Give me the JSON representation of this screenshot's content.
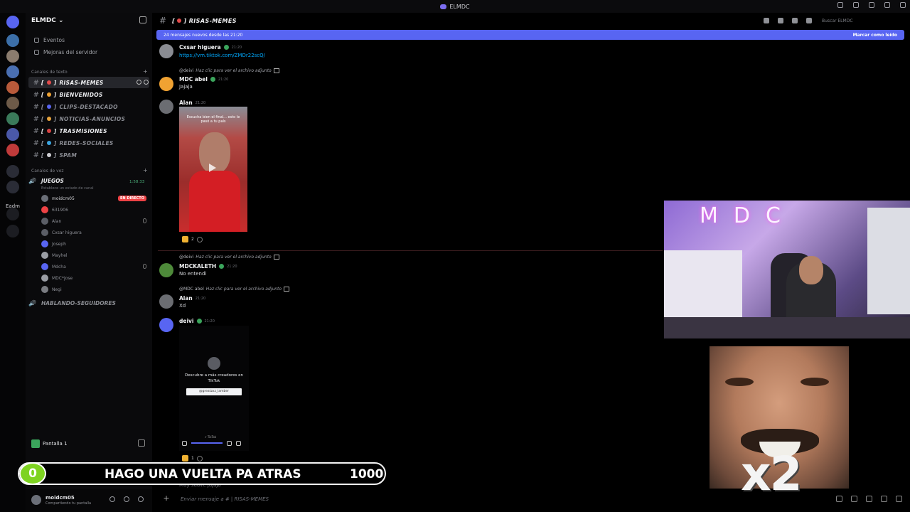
{
  "window": {
    "title": "ELMDC"
  },
  "server": {
    "name": "ELMDC",
    "links": [
      "Eventos",
      "Mejoras del servidor"
    ],
    "rail_label": "Eadm"
  },
  "text_category": "Canales de texto",
  "text_channels": [
    {
      "name": "RISAS-MEMES",
      "active": true
    },
    {
      "name": "BIENVENIDOS",
      "bright": true
    },
    {
      "name": "CLIPS-DESTACADO"
    },
    {
      "name": "NOTICIAS-ANUNCIOS"
    },
    {
      "name": "TRASMISIONES",
      "bright": true
    },
    {
      "name": "REDES-SOCIALES"
    },
    {
      "name": "SPAM"
    }
  ],
  "voice_category": "Canales de voz",
  "voice_channel": {
    "name": "JUEGOS",
    "time": "1:58:33",
    "status": "Establece un estado de canal",
    "users": [
      {
        "name": "moidcm05",
        "live": "EN DIRECTO",
        "color": "#6b6f78"
      },
      {
        "name": "631906",
        "color": "#ed4245"
      },
      {
        "name": "Alan",
        "color": "#5b5e66"
      },
      {
        "name": "Cxsar higuera",
        "color": "#5b5e66"
      },
      {
        "name": "Joseph",
        "color": "#5865f2"
      },
      {
        "name": "Mayhel",
        "color": "#9a9da4"
      },
      {
        "name": "Mdcha",
        "color": "#5865f2"
      },
      {
        "name": "MDC*jose",
        "color": "#9a9da4"
      },
      {
        "name": "Negi",
        "color": "#7a7c82"
      }
    ]
  },
  "voice_channel_2": {
    "name": "HABLANDO-SEGUIDORES"
  },
  "screen_share": {
    "label": "Pantalla 1"
  },
  "user_panel": {
    "name": "moidcm05",
    "status": "Compartiendo tu pantalla"
  },
  "channel_header": {
    "title": "RISAS-MEMES",
    "search_placeholder": "Buscar ELMDC"
  },
  "new_messages_bar": {
    "text": "24 mensajes nuevos desde las 21:20",
    "action": "Marcar como leído"
  },
  "messages": [
    {
      "author": "Cxsar higuera",
      "time": "21:20",
      "link": "https://vm.tiktok.com/ZMDr22scQ/"
    },
    {
      "reply_to": "@deivi",
      "reply_text": "Haz clic para ver el archivo adjunto",
      "author": "MDC abel",
      "time": "21:20",
      "text": "Jajaja"
    },
    {
      "author": "Alan",
      "time": "21:20",
      "video_caption": "Escucha bien el final... esto le pasó a tu país",
      "reaction_count": "2"
    },
    {
      "reply_to": "@deivi",
      "reply_text": "Haz clic para ver el archivo adjunto",
      "author": "MDCKALETH",
      "time": "21:20",
      "text": "No entendi"
    },
    {
      "reply_to": "@MDC abel",
      "reply_text": "Haz clic para ver el archivo adjunto",
      "author": "Alan",
      "time": "21:20",
      "text": "Xd"
    },
    {
      "author": "deivi",
      "time": "21:20",
      "video_text": "Descubre a más creadores en TikTok",
      "video_button": "@greatzxz_lamber",
      "video_credit": "♪ TikTok",
      "reaction_count": "1"
    }
  ],
  "hidden_message": {
    "text": "Muy suave jajaja"
  },
  "composer": {
    "placeholder": "Enviar mensaje a # | RISAS-MEMES"
  },
  "overlay": {
    "goal_current": "0",
    "goal_title": "HAGO UNA VUELTA PA ATRAS",
    "goal_target": "1000",
    "goal_fraction": 0,
    "webcam_sign": "MDC",
    "multiplier": "x2"
  }
}
